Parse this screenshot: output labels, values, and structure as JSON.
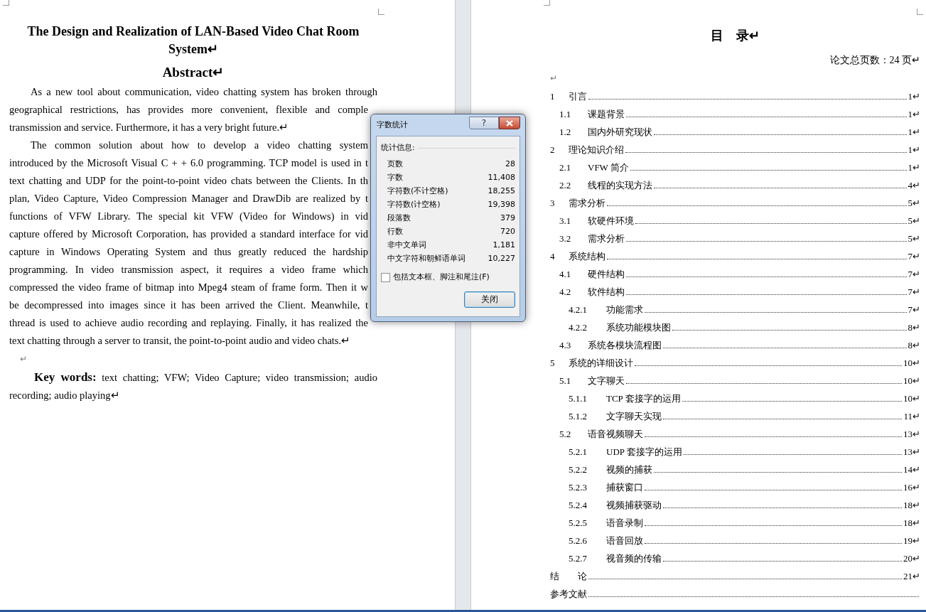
{
  "left_page": {
    "title": "The Design and Realization of LAN-Based Video Chat Room System↵",
    "heading": "Abstract↵",
    "paragraphs": [
      {
        "lines": [
          "As a new tool about communication, video chatting system has broken through",
          "geographical restrictions, has provides more convenient, flexible and comple",
          "transmission and service. Furthermore, it has a very bright future.↵"
        ]
      },
      {
        "lines": [
          "The common solution about how to develop a video chatting system",
          "introduced by the Microsoft Visual C + + 6.0 programming. TCP model is used in t",
          "text chatting and UDP for the point-to-point video chats between the Clients. In th",
          "plan, Video Capture, Video Compression Manager and DrawDib are realized by t",
          "functions of VFW Library. The special kit VFW (Video for Windows) in vid",
          "capture offered by Microsoft Corporation, has provided a standard interface for vid",
          "capture in Windows Operating System and thus greatly reduced the hardship",
          "programming. In video transmission aspect, it requires a video frame which",
          "compressed the video frame of bitmap into Mpeg4 steam of frame form. Then it w",
          "be decompressed into images since it has been arrived the Client. Meanwhile, t",
          "thread is used to achieve audio recording and replaying. Finally, it has realized the",
          "text chatting through a server to transit, the point-to-point audio and video chats.↵"
        ]
      }
    ],
    "blank_mark": "↵",
    "keywords": "**Key words:** text chatting; VFW; Video Capture; video transmission; audio recording; audio playing↵"
  },
  "right_page": {
    "title": "目　录↵",
    "page_count": "论文总页数：24 页↵",
    "blank_mark": "↵",
    "toc": [
      {
        "number": "1",
        "title": "引言",
        "page": "1↵",
        "children": [
          {
            "number": "1.1",
            "title": "课题背景",
            "page": "1↵"
          },
          {
            "number": "1.2",
            "title": "国内外研究现状",
            "page": "1↵"
          }
        ]
      },
      {
        "number": "2",
        "title": "理论知识介绍",
        "page": "1↵",
        "children": [
          {
            "number": "2.1",
            "title": "VFW 简介",
            "page": "1↵"
          },
          {
            "number": "2.2",
            "title": "线程的实现方法",
            "page": "4↵"
          }
        ]
      },
      {
        "number": "3",
        "title": "需求分析",
        "page": "5↵",
        "children": [
          {
            "number": "3.1",
            "title": "软硬件环境",
            "page": "5↵"
          },
          {
            "number": "3.2",
            "title": "需求分析",
            "page": "5↵"
          }
        ]
      },
      {
        "number": "4",
        "title": "系统结构",
        "page": "7↵",
        "children": [
          {
            "number": "4.1",
            "title": "硬件结构",
            "page": "7↵"
          },
          {
            "number": "4.2",
            "title": "软件结构",
            "page": "7↵",
            "children": [
              {
                "number": "4.2.1",
                "title": "功能需求",
                "page": "7↵"
              },
              {
                "number": "4.2.2",
                "title": "系统功能模块图",
                "page": "8↵"
              }
            ]
          },
          {
            "number": "4.3",
            "title": "系统各模块流程图",
            "page": "8↵"
          }
        ]
      },
      {
        "number": "5",
        "title": "系统的详细设计",
        "page": "10↵",
        "children": [
          {
            "number": "5.1",
            "title": "文字聊天",
            "page": "10↵",
            "children": [
              {
                "number": "5.1.1",
                "title": "TCP 套接字的运用",
                "page": "10↵"
              },
              {
                "number": "5.1.2",
                "title": "文字聊天实现",
                "page": "11↵"
              }
            ]
          },
          {
            "number": "5.2",
            "title": "语音视频聊天",
            "page": "13↵",
            "children": [
              {
                "number": "5.2.1",
                "title": "UDP 套接字的运用",
                "page": "13↵"
              },
              {
                "number": "5.2.2",
                "title": "视频的捕获",
                "page": "14↵"
              },
              {
                "number": "5.2.3",
                "title": "捕获窗口",
                "page": "16↵"
              },
              {
                "number": "5.2.4",
                "title": "视频捕获驱动",
                "page": "18↵"
              },
              {
                "number": "5.2.5",
                "title": "语音录制",
                "page": "18↵"
              },
              {
                "number": "5.2.6",
                "title": "语音回放",
                "page": "19↵"
              },
              {
                "number": "5.2.7",
                "title": "视音频的传输",
                "page": "20↵"
              }
            ]
          }
        ]
      },
      {
        "title": "结　　论",
        "page": "21↵"
      },
      {
        "title": "参考文献"
      }
    ]
  },
  "dialog": {
    "title": "字数统计",
    "help": "?",
    "section": "统计信息:",
    "stats": [
      {
        "label": "页数",
        "value": "28"
      },
      {
        "label": "字数",
        "value": "11,408"
      },
      {
        "label": "字符数(不计空格)",
        "value": "18,255"
      },
      {
        "label": "字符数(计空格)",
        "value": "19,398"
      },
      {
        "label": "段落数",
        "value": "379"
      },
      {
        "label": "行数",
        "value": "720"
      },
      {
        "label": "非中文单词",
        "value": "1,181"
      },
      {
        "label": "中文字符和朝鲜语单词",
        "value": "10,227"
      }
    ],
    "checkbox": {
      "label": "包括文本框、脚注和尾注(F)",
      "checked": false
    },
    "button": "关闭"
  }
}
